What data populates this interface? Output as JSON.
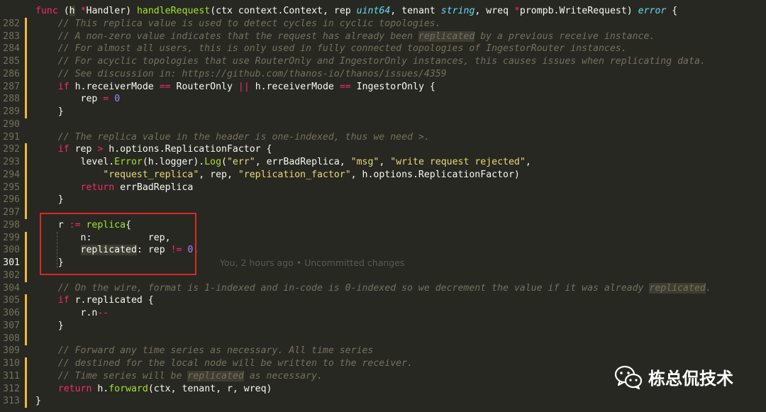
{
  "editor": {
    "lines": [
      {
        "no": "",
        "segs": [
          {
            "t": "func",
            "c": "k"
          },
          {
            "t": " ("
          },
          {
            "t": "h",
            "c": "hl"
          },
          {
            "t": " "
          },
          {
            "t": "*",
            "c": "k"
          },
          {
            "t": "Handler) "
          },
          {
            "t": "handleRequest",
            "c": "f"
          },
          {
            "t": "(ctx context.Context, rep "
          },
          {
            "t": "uint64",
            "c": "ty"
          },
          {
            "t": ", tenant "
          },
          {
            "t": "string",
            "c": "ty"
          },
          {
            "t": ", wreq "
          },
          {
            "t": "*",
            "c": "k"
          },
          {
            "t": "prompb.WriteRequest) "
          },
          {
            "t": "error",
            "c": "ty"
          },
          {
            "t": " {"
          }
        ]
      },
      {
        "no": "282",
        "segs": [
          {
            "t": "    // This replica value is used to detect cycles in cyclic topologies.",
            "c": "c"
          }
        ]
      },
      {
        "no": "283",
        "segs": [
          {
            "t": "    // A non-zero value indicates that the request has already been ",
            "c": "c"
          },
          {
            "t": "replicated",
            "c": "c-hl"
          },
          {
            "t": " by a previous receive instance.",
            "c": "c"
          }
        ]
      },
      {
        "no": "284",
        "segs": [
          {
            "t": "    // For almost all users, this is only used in fully connected topologies of IngestorRouter instances.",
            "c": "c"
          }
        ]
      },
      {
        "no": "285",
        "segs": [
          {
            "t": "    // For acyclic topologies that use RouterOnly and IngestorOnly instances, this causes issues when replicating data.",
            "c": "c"
          }
        ]
      },
      {
        "no": "286",
        "segs": [
          {
            "t": "    // See discussion in: https://github.com/thanos-io/thanos/issues/4359",
            "c": "c"
          }
        ]
      },
      {
        "no": "287",
        "segs": [
          {
            "t": "    "
          },
          {
            "t": "if",
            "c": "k"
          },
          {
            "t": " h.receiverMode "
          },
          {
            "t": "==",
            "c": "k"
          },
          {
            "t": " RouterOnly "
          },
          {
            "t": "||",
            "c": "k"
          },
          {
            "t": " h.receiverMode "
          },
          {
            "t": "==",
            "c": "k"
          },
          {
            "t": " IngestorOnly {"
          }
        ]
      },
      {
        "no": "288",
        "segs": [
          {
            "t": "        rep "
          },
          {
            "t": "=",
            "c": "k"
          },
          {
            "t": " "
          },
          {
            "t": "0",
            "c": "n"
          }
        ]
      },
      {
        "no": "289",
        "segs": [
          {
            "t": "    }"
          }
        ]
      },
      {
        "no": "290",
        "segs": [
          {
            "t": ""
          }
        ]
      },
      {
        "no": "291",
        "segs": [
          {
            "t": "    // The replica value in the header is one-indexed, thus we need >.",
            "c": "c"
          }
        ]
      },
      {
        "no": "292",
        "segs": [
          {
            "t": "    "
          },
          {
            "t": "if",
            "c": "k"
          },
          {
            "t": " rep "
          },
          {
            "t": ">",
            "c": "k"
          },
          {
            "t": " h.options.ReplicationFactor {"
          }
        ]
      },
      {
        "no": "293",
        "segs": [
          {
            "t": "        level."
          },
          {
            "t": "Error",
            "c": "f"
          },
          {
            "t": "(h.logger)."
          },
          {
            "t": "Log",
            "c": "f"
          },
          {
            "t": "("
          },
          {
            "t": "\"err\"",
            "c": "s"
          },
          {
            "t": ", errBadReplica, "
          },
          {
            "t": "\"msg\"",
            "c": "s"
          },
          {
            "t": ", "
          },
          {
            "t": "\"write request rejected\"",
            "c": "s"
          },
          {
            "t": ","
          }
        ]
      },
      {
        "no": "294",
        "segs": [
          {
            "t": "            "
          },
          {
            "t": "\"request_replica\"",
            "c": "s"
          },
          {
            "t": ", rep, "
          },
          {
            "t": "\"replication_factor\"",
            "c": "s"
          },
          {
            "t": ", h.options.ReplicationFactor)"
          }
        ]
      },
      {
        "no": "295",
        "segs": [
          {
            "t": "        "
          },
          {
            "t": "return",
            "c": "k"
          },
          {
            "t": " errBadReplica"
          }
        ]
      },
      {
        "no": "296",
        "segs": [
          {
            "t": "    }"
          }
        ]
      },
      {
        "no": "297",
        "segs": [
          {
            "t": ""
          }
        ]
      },
      {
        "no": "298",
        "segs": [
          {
            "t": "    r "
          },
          {
            "t": ":=",
            "c": "k"
          },
          {
            "t": " "
          },
          {
            "t": "replica",
            "c": "f"
          },
          {
            "t": "{"
          }
        ]
      },
      {
        "no": "299",
        "segs": [
          {
            "t": "        n:          rep,"
          }
        ]
      },
      {
        "no": "300",
        "segs": [
          {
            "t": "        "
          },
          {
            "t": "replicated",
            "c": "hl"
          },
          {
            "t": ": rep "
          },
          {
            "t": "!=",
            "c": "k"
          },
          {
            "t": " "
          },
          {
            "t": "0",
            "c": "n"
          },
          {
            "t": ","
          }
        ]
      },
      {
        "no": "301",
        "segs": [
          {
            "t": "    }"
          }
        ]
      },
      {
        "no": "302",
        "segs": [
          {
            "t": ""
          }
        ]
      },
      {
        "no": "304",
        "segs": [
          {
            "t": "    // On the wire, format is 1-indexed and in-code is 0-indexed so we decrement the value if it was already ",
            "c": "c"
          },
          {
            "t": "replicated",
            "c": "c-hl"
          },
          {
            "t": ".",
            "c": "c"
          }
        ]
      },
      {
        "no": "305",
        "segs": [
          {
            "t": "    "
          },
          {
            "t": "if",
            "c": "k"
          },
          {
            "t": " r.replicated {"
          }
        ]
      },
      {
        "no": "306",
        "segs": [
          {
            "t": "        r.n"
          },
          {
            "t": "--",
            "c": "k"
          }
        ]
      },
      {
        "no": "307",
        "segs": [
          {
            "t": "    }"
          }
        ]
      },
      {
        "no": "308",
        "segs": [
          {
            "t": ""
          }
        ]
      },
      {
        "no": "309",
        "segs": [
          {
            "t": "    // Forward any time series as necessary. All time series",
            "c": "c"
          }
        ]
      },
      {
        "no": "310",
        "segs": [
          {
            "t": "    // destined for the local node will be written to the receiver.",
            "c": "c"
          }
        ]
      },
      {
        "no": "311",
        "segs": [
          {
            "t": "    // Time series will be ",
            "c": "c"
          },
          {
            "t": "replicated",
            "c": "c-hl"
          },
          {
            "t": " as necessary.",
            "c": "c"
          }
        ]
      },
      {
        "no": "312",
        "segs": [
          {
            "t": "    "
          },
          {
            "t": "return",
            "c": "k"
          },
          {
            "t": " h."
          },
          {
            "t": "forward",
            "c": "f"
          },
          {
            "t": "(ctx, tenant, r, wreq)"
          }
        ]
      },
      {
        "no": "313",
        "segs": [
          {
            "t": "}"
          }
        ]
      }
    ],
    "line_numbers": [
      "",
      "282",
      "283",
      "284",
      "285",
      "286",
      "287",
      "288",
      "289",
      "290",
      "291",
      "292",
      "293",
      "294",
      "295",
      "296",
      "297",
      "298",
      "299",
      "300",
      "301",
      "302",
      "304",
      "305",
      "306",
      "307",
      "308",
      "309",
      "310",
      "311",
      "312",
      "313"
    ],
    "current_line": "301",
    "blame_hint": "You, 2 hours ago • Uncommitted changes"
  },
  "watermark": {
    "text": "栋总侃技术",
    "icon": "wechat-icon"
  },
  "colors": {
    "background": "#272822",
    "highlight_box": "#e02626",
    "modified_gutter": "#f0b640"
  }
}
